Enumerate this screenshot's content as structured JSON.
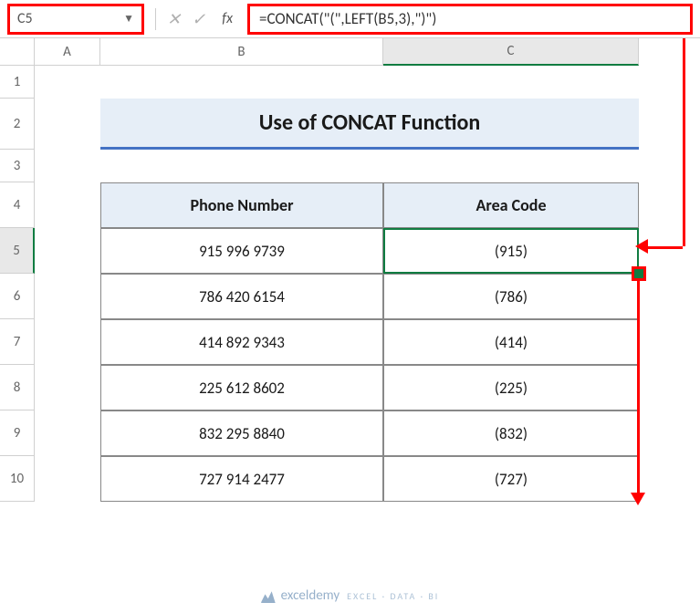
{
  "formula_bar": {
    "cell_reference": "C5",
    "formula": "=CONCAT(\"(\",LEFT(B5,3),\")\")"
  },
  "columns": {
    "A": "A",
    "B": "B",
    "C": "C"
  },
  "rows": [
    "1",
    "2",
    "3",
    "4",
    "5",
    "6",
    "7",
    "8",
    "9",
    "10"
  ],
  "title": "Use of CONCAT Function",
  "headers": {
    "phone": "Phone Number",
    "area": "Area Code"
  },
  "data": [
    {
      "phone": "915 996 9739",
      "area": "(915)"
    },
    {
      "phone": "786 420 6154",
      "area": "(786)"
    },
    {
      "phone": "414 892 9343",
      "area": "(414)"
    },
    {
      "phone": "225 612 8602",
      "area": "(225)"
    },
    {
      "phone": "832 295 8840",
      "area": "(832)"
    },
    {
      "phone": "727 914 2477",
      "area": "(727)"
    }
  ],
  "watermark": {
    "brand": "exceldemy",
    "tagline": "EXCEL · DATA · BI"
  },
  "chart_data": {
    "type": "table",
    "title": "Use of CONCAT Function",
    "columns": [
      "Phone Number",
      "Area Code"
    ],
    "rows": [
      [
        "915 996 9739",
        "(915)"
      ],
      [
        "786 420 6154",
        "(786)"
      ],
      [
        "414 892 9343",
        "(414)"
      ],
      [
        "225 612 8602",
        "(225)"
      ],
      [
        "832 295 8840",
        "(832)"
      ],
      [
        "727 914 2477",
        "(727)"
      ]
    ],
    "active_cell": "C5",
    "formula": "=CONCAT(\"(\",LEFT(B5,3),\")\")"
  }
}
